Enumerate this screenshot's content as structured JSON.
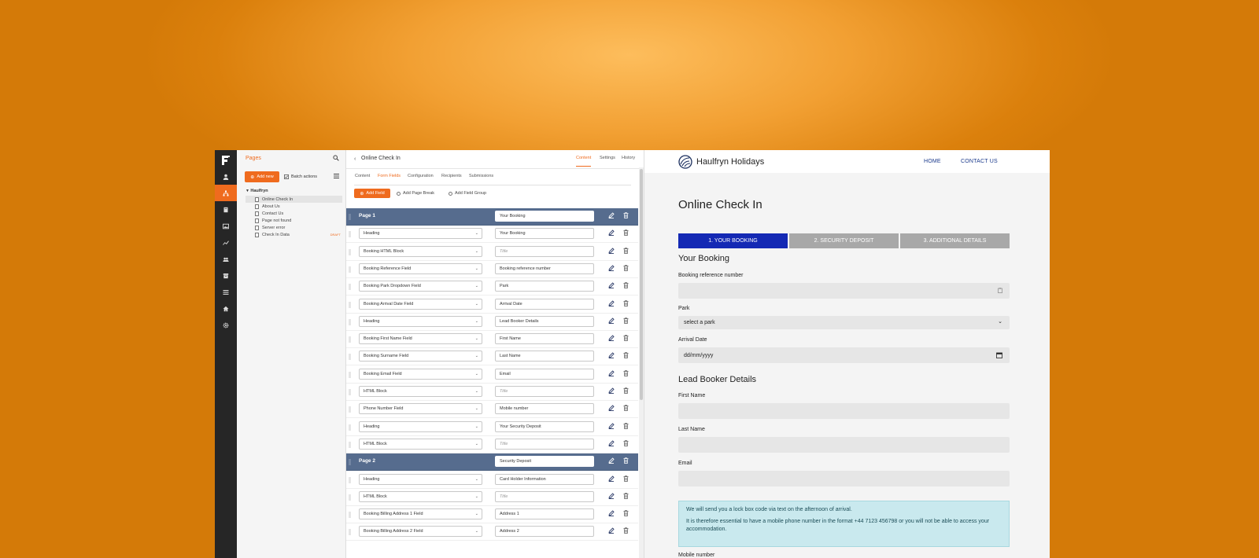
{
  "pages_panel": {
    "title": "Pages",
    "add_new": "Add new",
    "batch_actions": "Batch actions",
    "tree": {
      "root": "Haulfryn",
      "items": [
        {
          "label": "Online Check In",
          "selected": true,
          "badge": ""
        },
        {
          "label": "About Us",
          "selected": false,
          "badge": ""
        },
        {
          "label": "Contact Us",
          "selected": false,
          "badge": ""
        },
        {
          "label": "Page not found",
          "selected": false,
          "badge": ""
        },
        {
          "label": "Server error",
          "selected": false,
          "badge": ""
        },
        {
          "label": "Check In Data",
          "selected": false,
          "badge": "DRAFT"
        }
      ]
    }
  },
  "editor": {
    "title": "Online Check In",
    "top_tabs": [
      "Content",
      "Settings",
      "History"
    ],
    "active_top_tab": "Content",
    "sub_tabs": [
      "Content",
      "Form Fields",
      "Configuration",
      "Recipients",
      "Submissions"
    ],
    "active_sub_tab": "Form Fields",
    "add_field": "Add Field",
    "add_page_break": "Add Page Break",
    "add_field_group": "Add Field Group",
    "rows": [
      {
        "kind": "page",
        "label": "Page 1",
        "value": "Your Booking"
      },
      {
        "kind": "field",
        "type": "Heading",
        "value": "Your Booking",
        "placeholder": false
      },
      {
        "kind": "field",
        "type": "Booking HTML Block",
        "value": "Title",
        "placeholder": true
      },
      {
        "kind": "field",
        "type": "Booking Reference Field",
        "value": "Booking reference number",
        "placeholder": false
      },
      {
        "kind": "field",
        "type": "Booking Park Dropdown Field",
        "value": "Park",
        "placeholder": false
      },
      {
        "kind": "field",
        "type": "Booking Arrival Date Field",
        "value": "Arrival Date",
        "placeholder": false
      },
      {
        "kind": "field",
        "type": "Heading",
        "value": "Lead Booker Details",
        "placeholder": false
      },
      {
        "kind": "field",
        "type": "Booking First Name Field",
        "value": "First Name",
        "placeholder": false
      },
      {
        "kind": "field",
        "type": "Booking Surname Field",
        "value": "Last Name",
        "placeholder": false
      },
      {
        "kind": "field",
        "type": "Booking Email Field",
        "value": "Email",
        "placeholder": false
      },
      {
        "kind": "field",
        "type": "HTML Block",
        "value": "Title",
        "placeholder": true
      },
      {
        "kind": "field",
        "type": "Phone Number Field",
        "value": "Mobile number",
        "placeholder": false
      },
      {
        "kind": "field",
        "type": "Heading",
        "value": "Your Security Deposit",
        "placeholder": false
      },
      {
        "kind": "field",
        "type": "HTML Block",
        "value": "Title",
        "placeholder": true
      },
      {
        "kind": "page",
        "label": "Page 2",
        "value": "Security Deposit"
      },
      {
        "kind": "field",
        "type": "Heading",
        "value": "Card Holder Information",
        "placeholder": false
      },
      {
        "kind": "field",
        "type": "HTML Block",
        "value": "Title",
        "placeholder": true
      },
      {
        "kind": "field",
        "type": "Booking Billing Address 1 Field",
        "value": "Address 1",
        "placeholder": false
      },
      {
        "kind": "field",
        "type": "Booking Billing Address 2 Field",
        "value": "Address 2",
        "placeholder": false
      }
    ]
  },
  "preview": {
    "brand": "Haulfryn Holidays",
    "nav": [
      "HOME",
      "CONTACT US"
    ],
    "title": "Online Check In",
    "steps": [
      "1. YOUR BOOKING",
      "2. SECURITY DEPOSIT",
      "3. ADDITIONAL DETAILS"
    ],
    "active_step_color": "#1429b4",
    "inactive_step_color": "#a8a8a8",
    "section1": "Your Booking",
    "booking_ref_label": "Booking reference number",
    "park_label": "Park",
    "park_value": "select a park",
    "arrival_label": "Arrival Date",
    "arrival_placeholder": "dd/mm/yyyy",
    "section2": "Lead Booker Details",
    "first_name_label": "First Name",
    "last_name_label": "Last Name",
    "email_label": "Email",
    "info_line1": "We will send you a lock box code via text on the afternoon of arrival.",
    "info_line2": "It is therefore essential to have a mobile phone number in the format +44 7123 456798 or you will not be able to access your accommodation.",
    "mobile_label": "Mobile number"
  },
  "colors": {
    "accent": "#ef6b1e",
    "page_row": "#566c8e",
    "rail": "#262626",
    "background": "#e38a12"
  }
}
